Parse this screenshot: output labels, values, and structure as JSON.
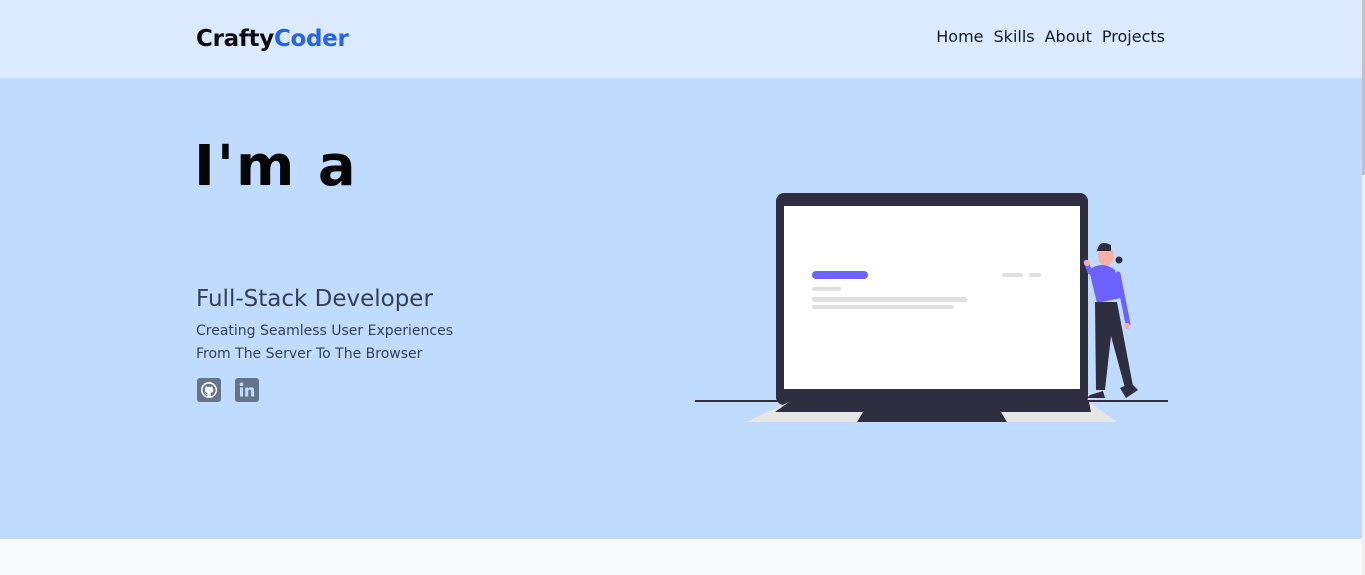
{
  "header": {
    "logo_part1": "Crafty",
    "logo_part2": "Coder",
    "nav": [
      "Home",
      "Skills",
      "About",
      "Projects"
    ]
  },
  "hero": {
    "headline": "I'm a",
    "role": "Full-Stack Developer",
    "tagline_line1": "Creating Seamless User Experiences",
    "tagline_line2": "From The Server To The Browser",
    "social_icons": [
      "github-icon",
      "linkedin-icon"
    ]
  },
  "colors": {
    "header_bg": "#dbeafe",
    "hero_bg": "#bfdbfe",
    "accent": "#2563eb",
    "illustration_accent": "#6c63ff"
  }
}
